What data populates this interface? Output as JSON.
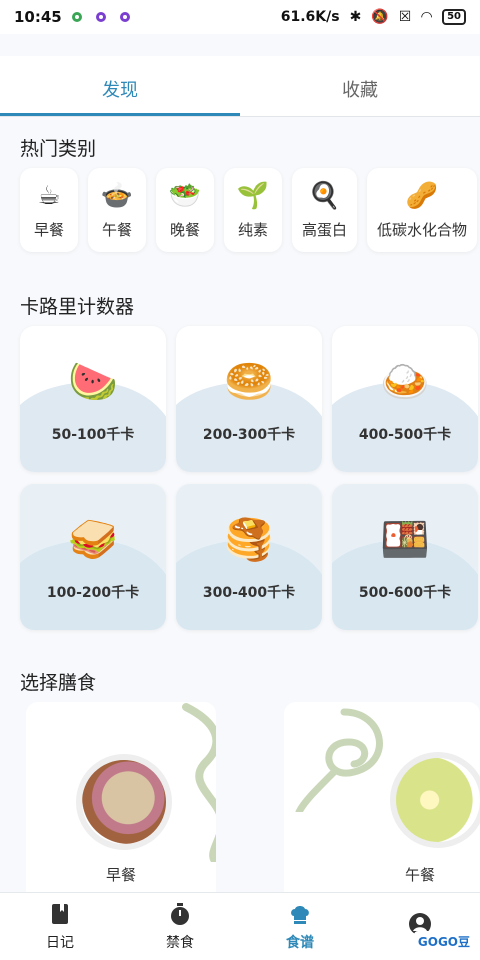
{
  "status_bar": {
    "time": "10:45",
    "network_speed": "61.6K/s",
    "battery": "50"
  },
  "tabs": [
    {
      "label": "发现",
      "active": true
    },
    {
      "label": "收藏",
      "active": false
    }
  ],
  "hot_categories": {
    "title": "热门类别",
    "items": [
      {
        "label": "早餐",
        "icon": "coffee-cup-icon"
      },
      {
        "label": "午餐",
        "icon": "stew-pot-icon"
      },
      {
        "label": "晚餐",
        "icon": "salad-icon"
      },
      {
        "label": "纯素",
        "icon": "seedling-icon"
      },
      {
        "label": "高蛋白",
        "icon": "fried-egg-pan-icon"
      },
      {
        "label": "低碳水化合物",
        "icon": "peanut-icon"
      }
    ]
  },
  "calorie_counter": {
    "title": "卡路里计数器",
    "items": [
      {
        "range": "50-100千卡",
        "icon": "watermelon-icon"
      },
      {
        "range": "200-300千卡",
        "icon": "bagel-icon"
      },
      {
        "range": "400-500千卡",
        "icon": "curry-rice-icon"
      },
      {
        "range": "100-200千卡",
        "icon": "sandwich-icon"
      },
      {
        "range": "300-400千卡",
        "icon": "pancakes-icon"
      },
      {
        "range": "500-600千卡",
        "icon": "bento-box-icon"
      }
    ]
  },
  "meal_select": {
    "title": "选择膳食",
    "items": [
      {
        "label": "早餐"
      },
      {
        "label": "午餐"
      }
    ]
  },
  "bottom_nav": [
    {
      "label": "日记",
      "icon": "diary-icon",
      "active": false
    },
    {
      "label": "禁食",
      "icon": "stopwatch-icon",
      "active": false
    },
    {
      "label": "食谱",
      "icon": "chef-hat-icon",
      "active": true
    },
    {
      "label": "",
      "icon": "profile-icon",
      "active": false
    }
  ],
  "watermark": "GOGO豆"
}
